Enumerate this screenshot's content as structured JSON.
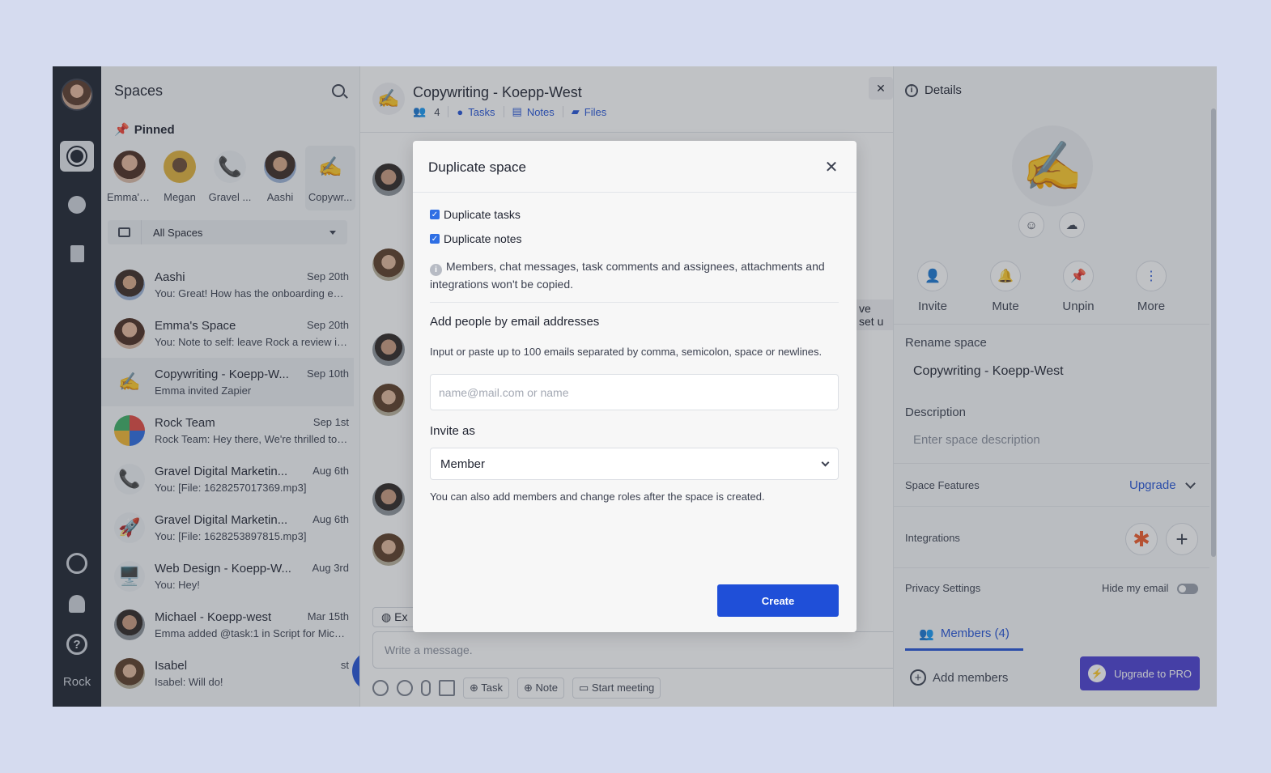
{
  "rail": {
    "brand": "Rock"
  },
  "spaces": {
    "title": "Spaces",
    "pinned_title": "Pinned",
    "pinned": [
      {
        "name": "Emma's...",
        "emoji": ""
      },
      {
        "name": "Megan",
        "emoji": ""
      },
      {
        "name": "Gravel ...",
        "emoji": "📞"
      },
      {
        "name": "Aashi",
        "emoji": ""
      },
      {
        "name": "Copywr...",
        "emoji": "✍️"
      }
    ],
    "filter": "All Spaces",
    "list": [
      {
        "name": "Aashi",
        "date": "Sep 20th",
        "preview": "You: Great! How has the onboarding exp...",
        "emoji": ""
      },
      {
        "name": "Emma's Space",
        "date": "Sep 20th",
        "preview": "You: Note to self: leave Rock a review in ...",
        "emoji": ""
      },
      {
        "name": "Copywriting - Koepp-W...",
        "date": "Sep 10th",
        "preview": "Emma invited Zapier",
        "emoji": "✍️"
      },
      {
        "name": "Rock Team",
        "date": "Sep 1st",
        "preview": "Rock Team: Hey there, We're thrilled to a...",
        "emoji": ""
      },
      {
        "name": "Gravel Digital Marketin...",
        "date": "Aug 6th",
        "preview": "You: [File: 1628257017369.mp3]",
        "emoji": "📞"
      },
      {
        "name": "Gravel Digital Marketin...",
        "date": "Aug 6th",
        "preview": "You: [File: 1628253897815.mp3]",
        "emoji": "🚀"
      },
      {
        "name": "Web Design - Koepp-W...",
        "date": "Aug 3rd",
        "preview": "You: Hey!",
        "emoji": "🖥️"
      },
      {
        "name": "Michael - Koepp-west",
        "date": "Mar 15th",
        "preview": "Emma added @task:1 in Script for Mich...",
        "emoji": ""
      },
      {
        "name": "Isabel",
        "date": "st",
        "preview": "Isabel: Will do!",
        "emoji": ""
      }
    ]
  },
  "chat": {
    "title": "Copywriting - Koepp-West",
    "emoji": "✍️",
    "member_count": "4",
    "tabs": {
      "tasks": "Tasks",
      "notes": "Notes",
      "files": "Files"
    },
    "peek_text": "ve set u",
    "ext_label": "Ex",
    "composer_placeholder": "Write a message.",
    "task_chip": "Task",
    "note_chip": "Note",
    "meeting_chip": "Start meeting"
  },
  "details": {
    "title": "Details",
    "emoji": "✍️",
    "actions": [
      "Invite",
      "Mute",
      "Unpin",
      "More"
    ],
    "rename_label": "Rename space",
    "rename_value": "Copywriting - Koepp-West",
    "description_label": "Description",
    "description_placeholder": "Enter space description",
    "features_label": "Space Features",
    "upgrade": "Upgrade",
    "integrations_label": "Integrations",
    "privacy_label": "Privacy Settings",
    "hide_email": "Hide my email",
    "members_tab": "Members (4)",
    "add_members": "Add members",
    "upgrade_pro": "Upgrade to PRO"
  },
  "modal": {
    "title": "Duplicate space",
    "dup_tasks": "Duplicate tasks",
    "dup_notes": "Duplicate notes",
    "note": "Members, chat messages, task comments and assignees, attachments and integrations won't be copied.",
    "add_people_title": "Add people by email addresses",
    "add_people_hint": "Input or paste up to 100 emails separated by comma, semicolon, space or newlines.",
    "email_placeholder": "name@mail.com or name",
    "invite_as_label": "Invite as",
    "invite_as_value": "Member",
    "footer_hint": "You can also add members and change roles after the space is created.",
    "create": "Create"
  },
  "colors": {
    "accent": "#2453d6",
    "pro": "#4b3fd1",
    "rail": "#1d222e"
  }
}
